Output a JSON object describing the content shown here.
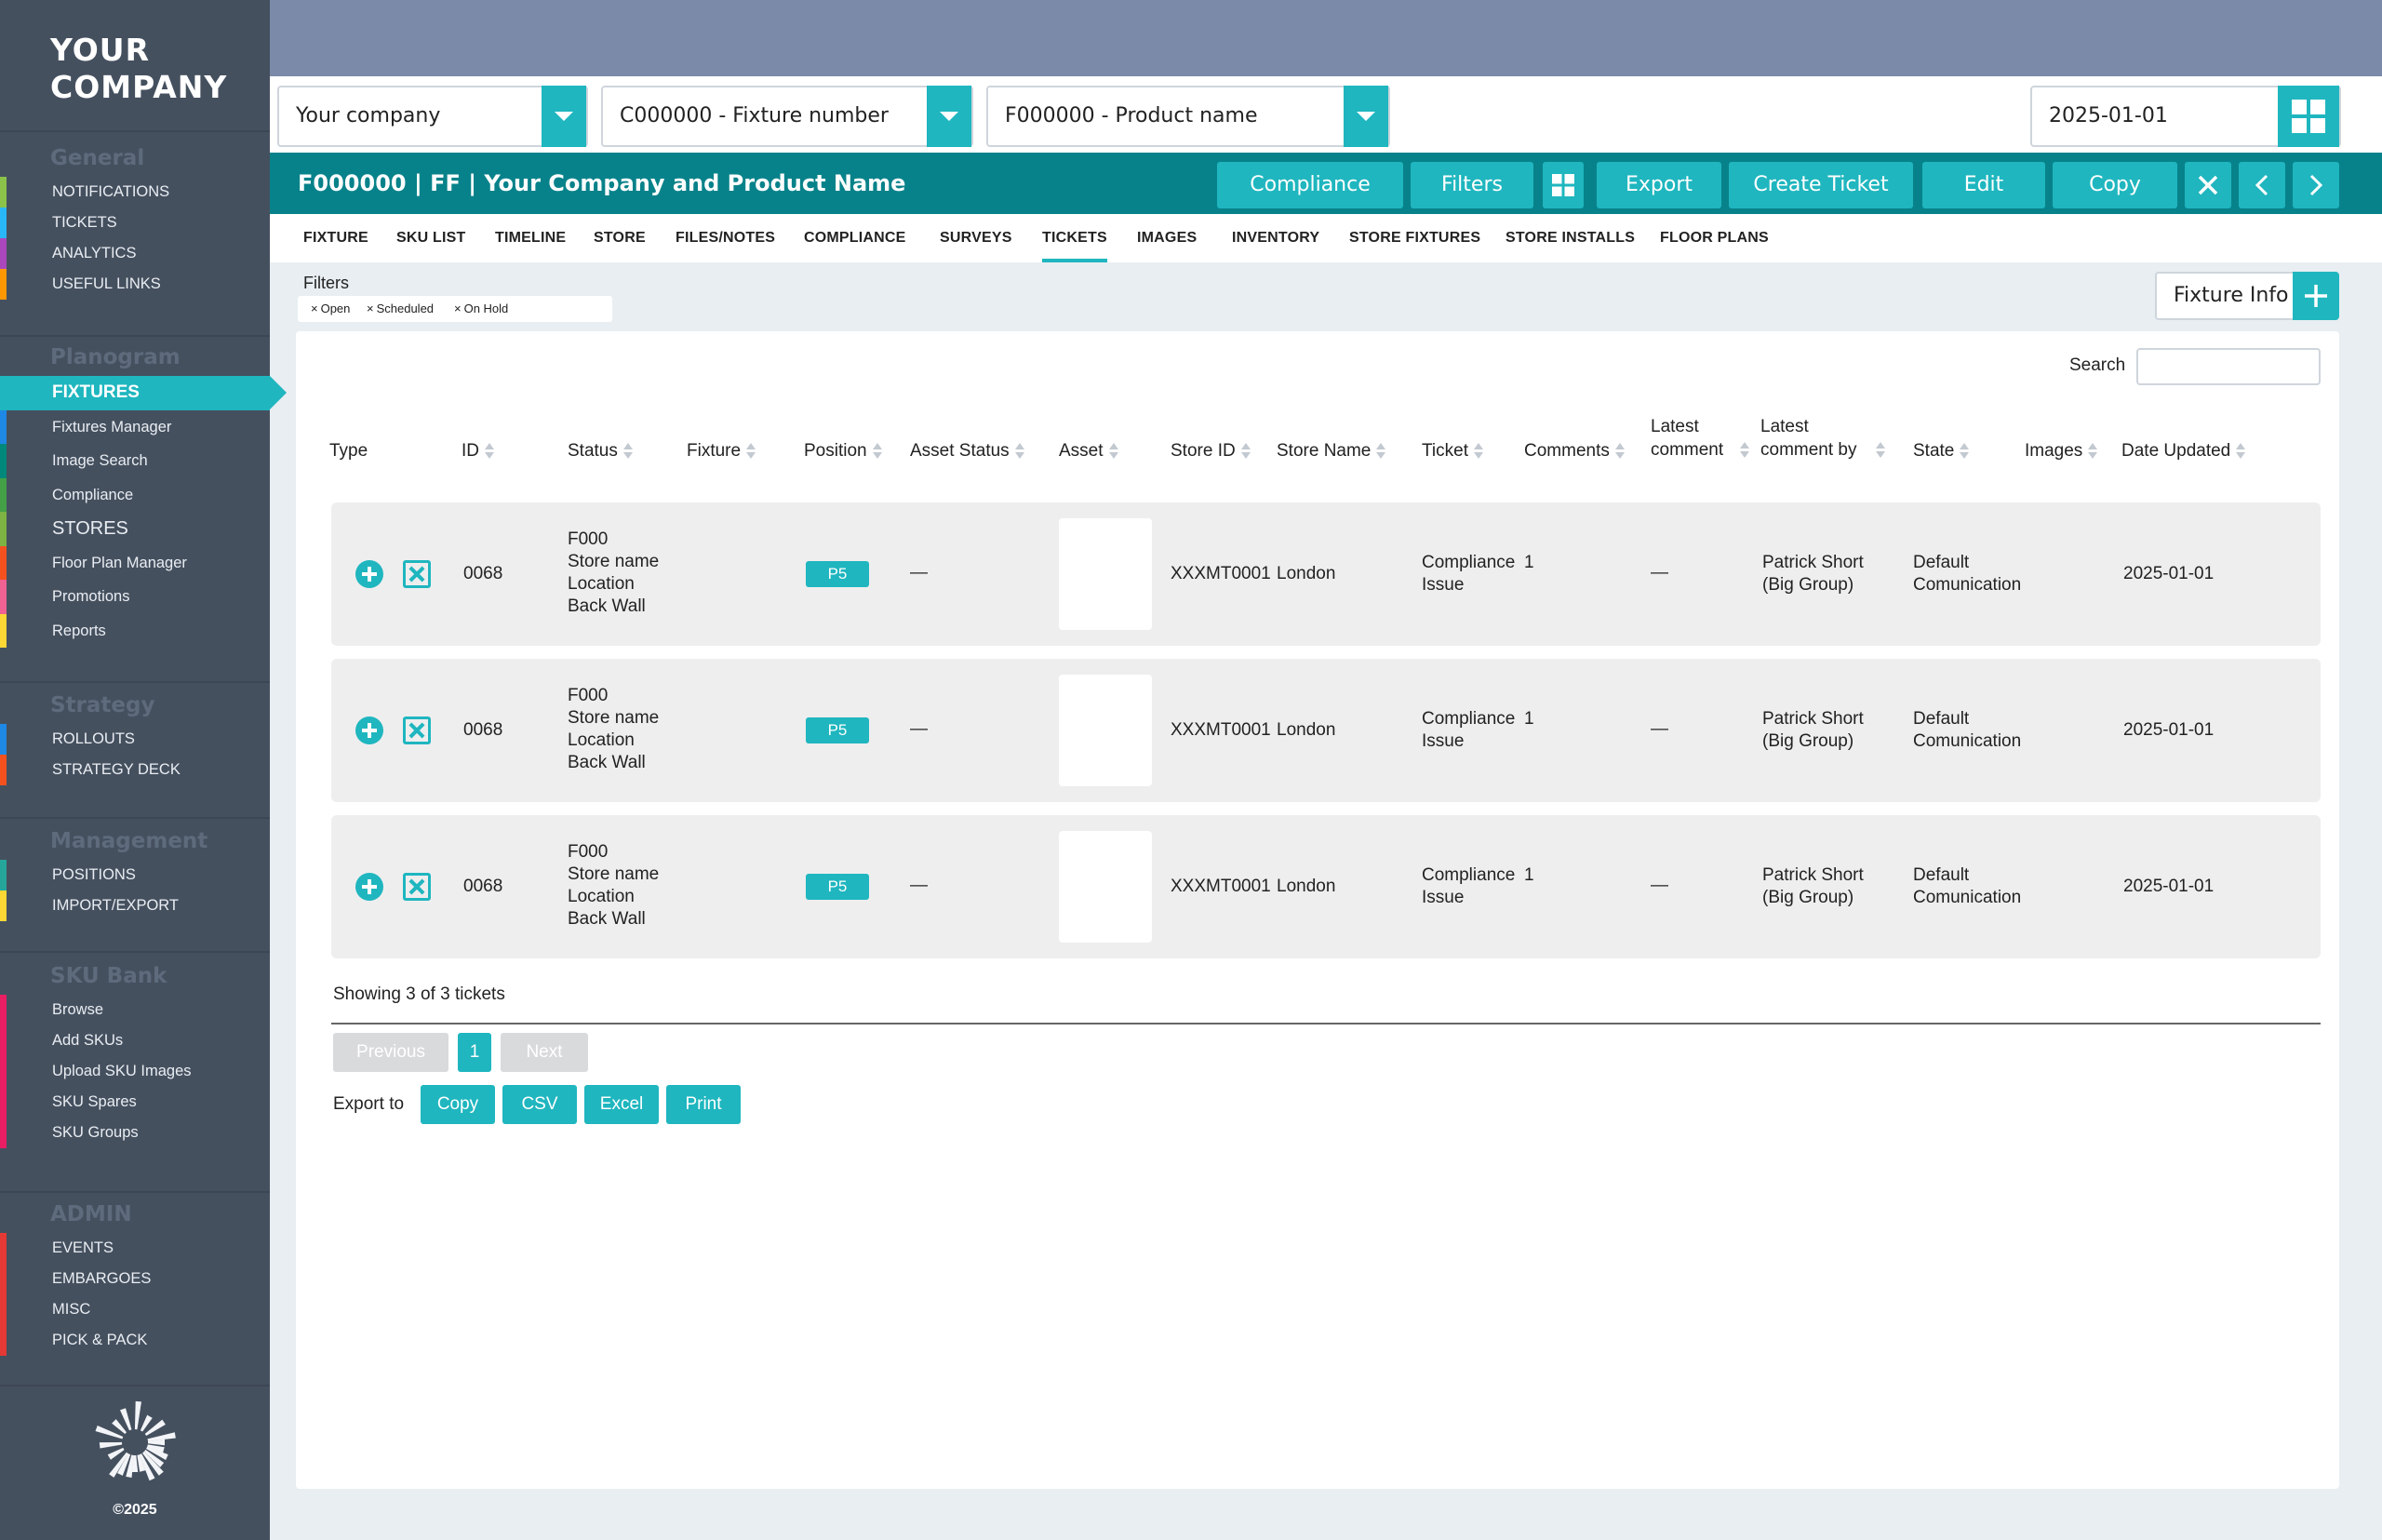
{
  "brand": {
    "line1": "YOUR",
    "line2": "COMPANY",
    "copyright": "©2025"
  },
  "sidebar": {
    "sections": [
      {
        "heading": "General",
        "items": [
          {
            "label": "NOTIFICATIONS",
            "color": "#8bc34a"
          },
          {
            "label": "TICKETS",
            "color": "#29b6f6"
          },
          {
            "label": "ANALYTICS",
            "color": "#ab47bc"
          },
          {
            "label": "USEFUL LINKS",
            "color": "#ff9800"
          }
        ]
      },
      {
        "heading": "Planogram",
        "items": [
          {
            "label": "FIXTURES",
            "color": "#1fb6bf",
            "active": true
          },
          {
            "label": "Fixtures Manager",
            "color": "#1e88e5"
          },
          {
            "label": "Image Search",
            "color": "#00897b"
          },
          {
            "label": "Compliance",
            "color": "#43a047"
          },
          {
            "label": "STORES",
            "color": "#7cb342"
          },
          {
            "label": "Floor Plan Manager",
            "color": "#f4511e"
          },
          {
            "label": "Promotions",
            "color": "#f06292"
          },
          {
            "label": "Reports",
            "color": "#fdd835"
          }
        ]
      },
      {
        "heading": "Strategy",
        "items": [
          {
            "label": "ROLLOUTS",
            "color": "#1e88e5"
          },
          {
            "label": "STRATEGY DECK",
            "color": "#f4511e"
          }
        ]
      },
      {
        "heading": "Management",
        "items": [
          {
            "label": "POSITIONS",
            "color": "#26a69a"
          },
          {
            "label": "IMPORT/EXPORT",
            "color": "#fdd835"
          }
        ]
      },
      {
        "heading": "SKU Bank",
        "items": [
          {
            "label": "Browse",
            "color": "#e91e63"
          },
          {
            "label": "Add SKUs",
            "color": "#e91e63"
          },
          {
            "label": "Upload SKU Images",
            "color": "#e91e63"
          },
          {
            "label": "SKU Spares",
            "color": "#e91e63"
          },
          {
            "label": "SKU Groups",
            "color": "#e91e63"
          }
        ]
      },
      {
        "heading": "ADMIN",
        "items": [
          {
            "label": "EVENTS",
            "color": "#e53935"
          },
          {
            "label": "EMBARGOES",
            "color": "#e53935"
          },
          {
            "label": "MISC",
            "color": "#e53935"
          },
          {
            "label": "PICK & PACK",
            "color": "#e53935"
          }
        ]
      }
    ]
  },
  "selectors": {
    "company": "Your company",
    "fixture": "C000000 - Fixture number",
    "product": "F000000 - Product name",
    "date": "2025-01-01"
  },
  "titlebar": {
    "title": "F000000 | FF | Your Company and Product Name",
    "buttons": {
      "compliance": "Compliance",
      "filters": "Filters",
      "export": "Export",
      "create_ticket": "Create Ticket",
      "edit": "Edit",
      "copy": "Copy"
    }
  },
  "tabs": [
    "FIXTURE",
    "SKU LIST",
    "TIMELINE",
    "STORE",
    "FILES/NOTES",
    "COMPLIANCE",
    "SURVEYS",
    "TICKETS",
    "IMAGES",
    "INVENTORY",
    "STORE FIXTURES",
    "STORE INSTALLS",
    "FLOOR PLANS"
  ],
  "active_tab": "TICKETS",
  "filters": {
    "label": "Filters",
    "chips": [
      "Open",
      "Scheduled",
      "On Hold"
    ]
  },
  "fixture_info": {
    "label": "Fixture Info"
  },
  "search": {
    "label": "Search",
    "value": ""
  },
  "table": {
    "columns": [
      "Type",
      "ID",
      "Status",
      "Fixture",
      "Position",
      "Asset Status",
      "Asset",
      "Store ID",
      "Store Name",
      "Ticket",
      "Comments",
      "Latest comment",
      "Latest comment by",
      "State",
      "Images",
      "Date Updated"
    ],
    "rows": [
      {
        "id": "0068",
        "status": [
          "F000",
          "Store name",
          "Location",
          "Back Wall"
        ],
        "position": "P5",
        "asset_status": "—",
        "store_id": "XXXMT0001",
        "store_name": "London",
        "ticket": [
          "Compliance",
          "Issue"
        ],
        "comments": "1",
        "latest_comment": "—",
        "latest_comment_by": [
          "Patrick Short",
          "(Big Group)"
        ],
        "state": [
          "Default",
          "Comunication"
        ],
        "date_updated": "2025-01-01"
      },
      {
        "id": "0068",
        "status": [
          "F000",
          "Store name",
          "Location",
          "Back Wall"
        ],
        "position": "P5",
        "asset_status": "—",
        "store_id": "XXXMT0001",
        "store_name": "London",
        "ticket": [
          "Compliance",
          "Issue"
        ],
        "comments": "1",
        "latest_comment": "—",
        "latest_comment_by": [
          "Patrick Short",
          "(Big Group)"
        ],
        "state": [
          "Default",
          "Comunication"
        ],
        "date_updated": "2025-01-01"
      },
      {
        "id": "0068",
        "status": [
          "F000",
          "Store name",
          "Location",
          "Back Wall"
        ],
        "position": "P5",
        "asset_status": "—",
        "store_id": "XXXMT0001",
        "store_name": "London",
        "ticket": [
          "Compliance",
          "Issue"
        ],
        "comments": "1",
        "latest_comment": "—",
        "latest_comment_by": [
          "Patrick Short",
          "(Big Group)"
        ],
        "state": [
          "Default",
          "Comunication"
        ],
        "date_updated": "2025-01-01"
      }
    ]
  },
  "pagination": {
    "showing": "Showing 3 of 3 tickets",
    "previous": "Previous",
    "page": "1",
    "next": "Next"
  },
  "export": {
    "label": "Export to",
    "buttons": [
      "Copy",
      "CSV",
      "Excel",
      "Print"
    ]
  },
  "colors": {
    "accent": "#1fb6bf",
    "titlebar": "#08828a",
    "sidebar": "#45505f",
    "topband": "#7a8aa8"
  }
}
